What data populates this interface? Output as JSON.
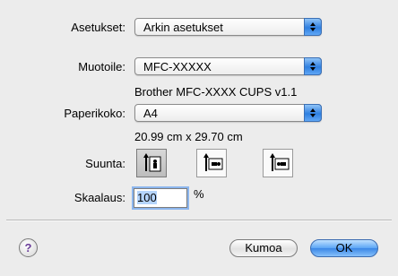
{
  "settings": {
    "label": "Asetukset:",
    "value": "Arkin asetukset"
  },
  "format_for": {
    "label": "Muotoile:",
    "value": "MFC-XXXXX",
    "info": "Brother MFC-XXXX CUPS v1.1"
  },
  "paper_size": {
    "label": "Paperikoko:",
    "value": "A4",
    "info": "20.99 cm x 29.70 cm"
  },
  "orientation": {
    "label": "Suunta:",
    "options": [
      "portrait",
      "landscape-left",
      "landscape-right"
    ],
    "selected": "portrait"
  },
  "scale": {
    "label": "Skaalaus:",
    "value": "100",
    "unit": "%"
  },
  "buttons": {
    "help": "?",
    "cancel": "Kumoa",
    "ok": "OK"
  }
}
